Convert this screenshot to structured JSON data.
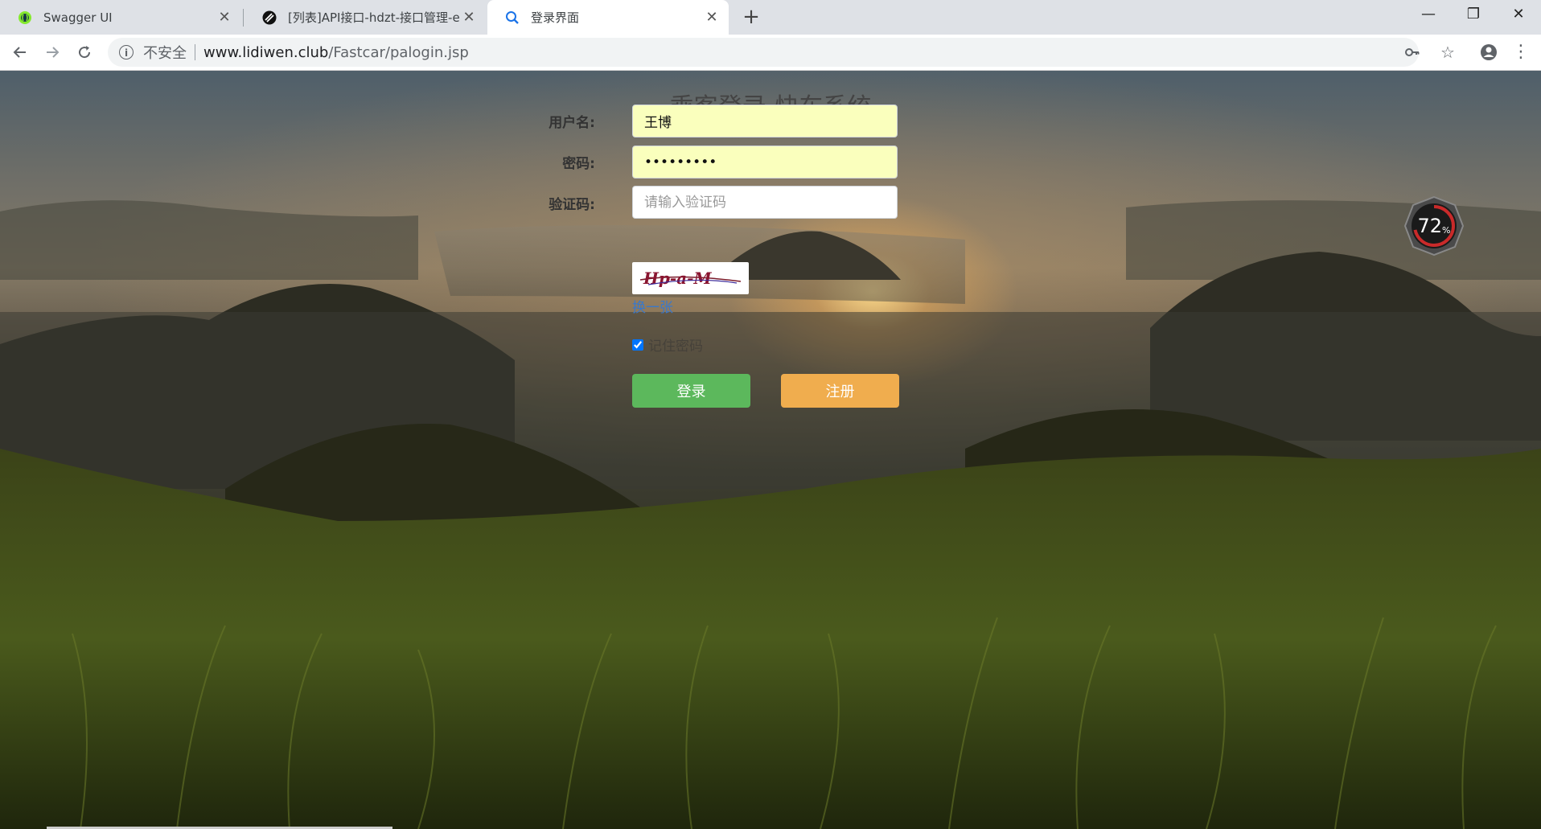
{
  "browser": {
    "tabs": [
      {
        "title": "Swagger UI",
        "icon": "swagger-icon",
        "active": false
      },
      {
        "title": "[列表]API接口-hdzt-接口管理-e",
        "icon": "api-icon",
        "active": false
      },
      {
        "title": "登录界面",
        "icon": "search-icon",
        "active": true
      }
    ],
    "new_tab": "+",
    "address": {
      "security_label": "不安全",
      "host": "www.lidiwen.club",
      "path": "/Fastcar/palogin.jsp"
    },
    "window_controls": {
      "minimize": "—",
      "restore": "❐",
      "close": "✕"
    }
  },
  "login": {
    "title": "乘客登录-快车系统",
    "username_label": "用户名:",
    "username_value": "王博",
    "password_label": "密码:",
    "password_value": "123456789",
    "captcha_label": "验证码:",
    "captcha_placeholder": "请输入验证码",
    "captcha_text": "Hp-a-M",
    "refresh_link": "换一张",
    "remember_label": "记住密码",
    "remember_checked": true,
    "login_button": "登录",
    "register_button": "注册"
  },
  "overlay": {
    "gauge_value": "72",
    "gauge_unit": "%"
  },
  "colors": {
    "login_button": "#5cb85c",
    "register_button": "#f0ad4e",
    "autofill_bg": "#faffbd",
    "link": "#3a78c9"
  }
}
